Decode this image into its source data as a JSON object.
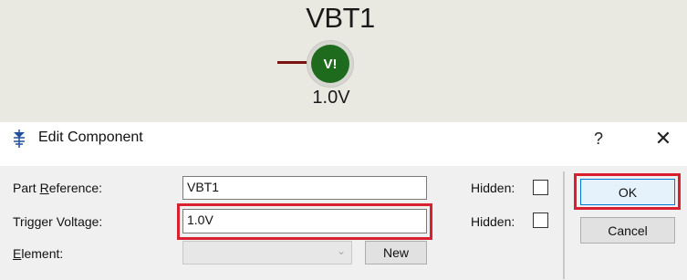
{
  "schematic": {
    "probe_reference": "VBT1",
    "probe_symbol": "V!",
    "probe_value": "1.0V"
  },
  "dialog": {
    "title": "Edit Component",
    "help_label": "?",
    "close_label": "✕",
    "fields": {
      "part_reference": {
        "label_pre": "Part ",
        "label_ul": "R",
        "label_post": "eference:",
        "value": "VBT1"
      },
      "trigger_voltage": {
        "label": "Trigger Voltage:",
        "value": "1.0V"
      },
      "element": {
        "label_ul": "E",
        "label_post": "lement:",
        "value": ""
      }
    },
    "hidden_label_1": "Hidden:",
    "hidden_label_2": "Hidden:",
    "new_button": "New",
    "ok_button": "OK",
    "cancel_button": "Cancel"
  },
  "colors": {
    "highlight": "#d8202e",
    "probe_green": "#1e6b1e",
    "wire": "#7a1212"
  }
}
